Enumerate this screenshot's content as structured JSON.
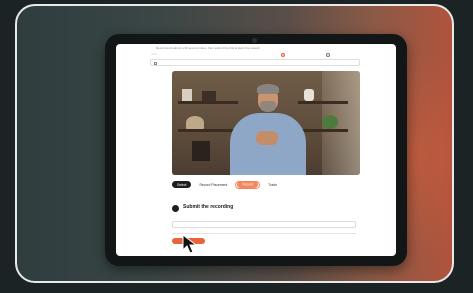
{
  "colors": {
    "accent": "#e8643c",
    "tab_highlight": "#f3875d",
    "frame_border": "#e9e9e9"
  },
  "screen": {
    "top_text": "Record and submit a 30 second video, then submit the link to Earn the reward",
    "badge": "",
    "options": [
      {
        "label": "",
        "selected": true
      },
      {
        "label": "",
        "selected": false
      }
    ],
    "prompt_row": "",
    "tabs": [
      {
        "label": "Select"
      },
      {
        "label": "Record Placement"
      },
      {
        "label": "Record"
      },
      {
        "label": "Trade"
      }
    ],
    "step_text": "",
    "submit": {
      "title": "Submit the recording",
      "subtitle": ""
    },
    "field_placeholder": "",
    "button_label": "",
    "button_note": ""
  },
  "icons": [
    "pointer-cursor-icon",
    "upload-icon",
    "camera-icon"
  ]
}
